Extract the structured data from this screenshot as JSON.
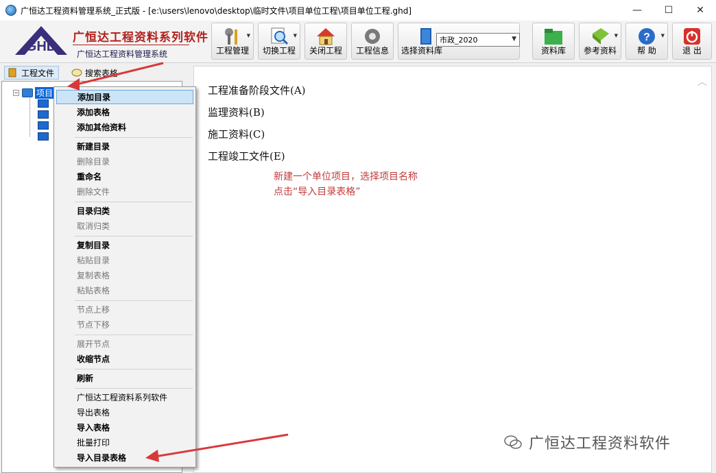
{
  "window": {
    "title": "广恒达工程资料管理系统_正式版 - [e:\\users\\lenovo\\desktop\\临时文件\\项目单位工程\\项目单位工程.ghd]",
    "controls": [
      "—",
      "☐",
      "✕"
    ]
  },
  "brand": {
    "name": "广恒达工程资料系列软件",
    "subtitle": "广恒达工程资料管理系统"
  },
  "toolbar": {
    "project_mgmt": "工程管理",
    "switch_project": "切换工程",
    "close_project": "关闭工程",
    "project_info": "工程信息",
    "select_library": "选择资料库",
    "library_value": "市政_2020",
    "material_library": "资料库",
    "reference": "参考资料",
    "help": "帮 助",
    "exit": "退 出"
  },
  "tabs": {
    "project_files": "工程文件",
    "search_tables": "搜索表格"
  },
  "tree": {
    "root_label": "项目"
  },
  "context_menu": {
    "items": [
      {
        "label": "添加目录",
        "state": "bold-highlight"
      },
      {
        "label": "添加表格",
        "state": "bold"
      },
      {
        "label": "添加其他资料",
        "state": "bold"
      },
      {
        "label": "新建目录",
        "state": "bold"
      },
      {
        "label": "删除目录",
        "state": "disabled"
      },
      {
        "label": "重命名",
        "state": "bold"
      },
      {
        "label": "删除文件",
        "state": "disabled"
      },
      {
        "label": "目录归类",
        "state": "bold"
      },
      {
        "label": "取消归类",
        "state": "disabled"
      },
      {
        "label": "复制目录",
        "state": "bold"
      },
      {
        "label": "粘贴目录",
        "state": "disabled"
      },
      {
        "label": "复制表格",
        "state": "disabled"
      },
      {
        "label": "粘贴表格",
        "state": "disabled"
      },
      {
        "label": "节点上移",
        "state": "disabled"
      },
      {
        "label": "节点下移",
        "state": "disabled"
      },
      {
        "label": "展开节点",
        "state": "disabled"
      },
      {
        "label": "收缩节点",
        "state": "bold"
      },
      {
        "label": "刷新",
        "state": "bold"
      },
      {
        "label": "广恒达工程资料系列软件",
        "state": "normal"
      },
      {
        "label": "导出表格",
        "state": "normal"
      },
      {
        "label": "导入表格",
        "state": "bold"
      },
      {
        "label": "批量打印",
        "state": "normal"
      },
      {
        "label": "导入目录表格",
        "state": "bold"
      }
    ]
  },
  "content": {
    "sections": [
      "工程准备阶段文件(A)",
      "监理资料(B)",
      "施工资料(C)",
      "工程竣工文件(E)"
    ],
    "note_line1": "新建一个单位项目，选择项目名称",
    "note_line2": "点击“导入目录表格”",
    "watermark": "广恒达工程资料软件"
  },
  "colors": {
    "brand_red": "#b0201c",
    "note_red": "#c23a3a",
    "highlight": "#cce4f7",
    "arrow_red": "#d9383a"
  }
}
